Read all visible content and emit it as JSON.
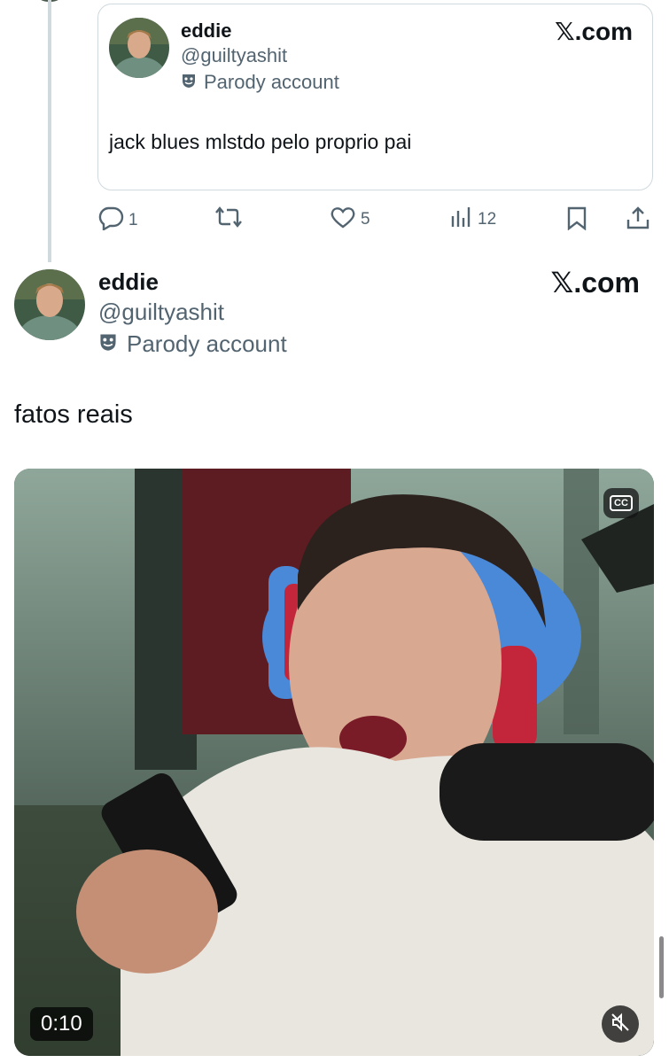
{
  "quoted_post": {
    "display_name": "eddie",
    "handle": "@guiltyashit",
    "parody_label": "Parody account",
    "brand": "𝕏.com",
    "text": "jack blues mlstdo pelo proprio pai",
    "stats": {
      "replies": "1",
      "likes": "5",
      "views": "12"
    }
  },
  "main_post": {
    "display_name": "eddie",
    "handle": "@guiltyashit",
    "parody_label": "Parody account",
    "brand": "𝕏.com",
    "text": "fatos reais",
    "video": {
      "cc_label": "CC",
      "time": "0:10",
      "muted": true
    }
  },
  "icons": [
    "reply-icon",
    "repost-icon",
    "like-icon",
    "views-icon",
    "bookmark-icon",
    "share-icon",
    "parody-mask-icon",
    "closed-captions-icon",
    "muted-speaker-icon"
  ],
  "colors": {
    "text": "#0f1419",
    "secondary": "#536471",
    "border": "#cfd9de"
  }
}
